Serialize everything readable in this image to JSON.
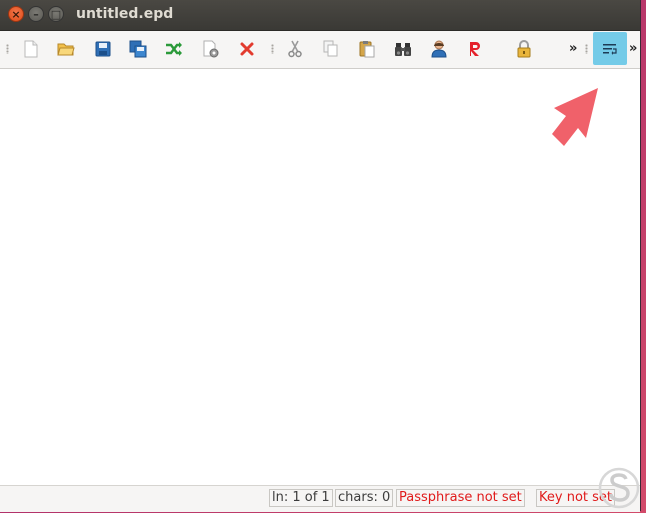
{
  "window": {
    "title": "untitled.epd"
  },
  "titlebar_buttons": [
    {
      "name": "close",
      "glyph": "×"
    },
    {
      "name": "minimize",
      "glyph": "–"
    },
    {
      "name": "maximize",
      "glyph": "□"
    }
  ],
  "toolbar": {
    "buttons": [
      {
        "name": "new-document",
        "icon": "new-document-icon"
      },
      {
        "name": "open",
        "icon": "open-folder-icon"
      },
      {
        "name": "save",
        "icon": "save-disk-icon"
      },
      {
        "name": "save-as",
        "icon": "save-as-icon"
      },
      {
        "name": "reload",
        "icon": "shuffle-arrows-icon"
      },
      {
        "name": "properties",
        "icon": "document-gear-icon"
      },
      {
        "name": "close-document",
        "icon": "red-x-icon"
      },
      {
        "name": "cut",
        "icon": "scissors-icon"
      },
      {
        "name": "copy",
        "icon": "copy-icon"
      },
      {
        "name": "paste",
        "icon": "paste-clipboard-icon"
      },
      {
        "name": "find",
        "icon": "binoculars-icon"
      },
      {
        "name": "set-key",
        "icon": "user-key-icon"
      },
      {
        "name": "recipients",
        "icon": "red-r-icon"
      },
      {
        "name": "passphrase",
        "icon": "padlock-icon"
      },
      {
        "name": "word-wrap",
        "icon": "word-wrap-icon",
        "highlighted": true
      }
    ],
    "overflow_glyph": "»"
  },
  "editor": {
    "content": ""
  },
  "statusbar": {
    "line": "ln: 1 of 1",
    "chars": "chars: 0",
    "passphrase": "Passphrase not set",
    "key": "Key not set"
  },
  "colors": {
    "highlight": "#74cbe8",
    "status_warning": "#e01b1b",
    "arrow": "#f0616a"
  }
}
